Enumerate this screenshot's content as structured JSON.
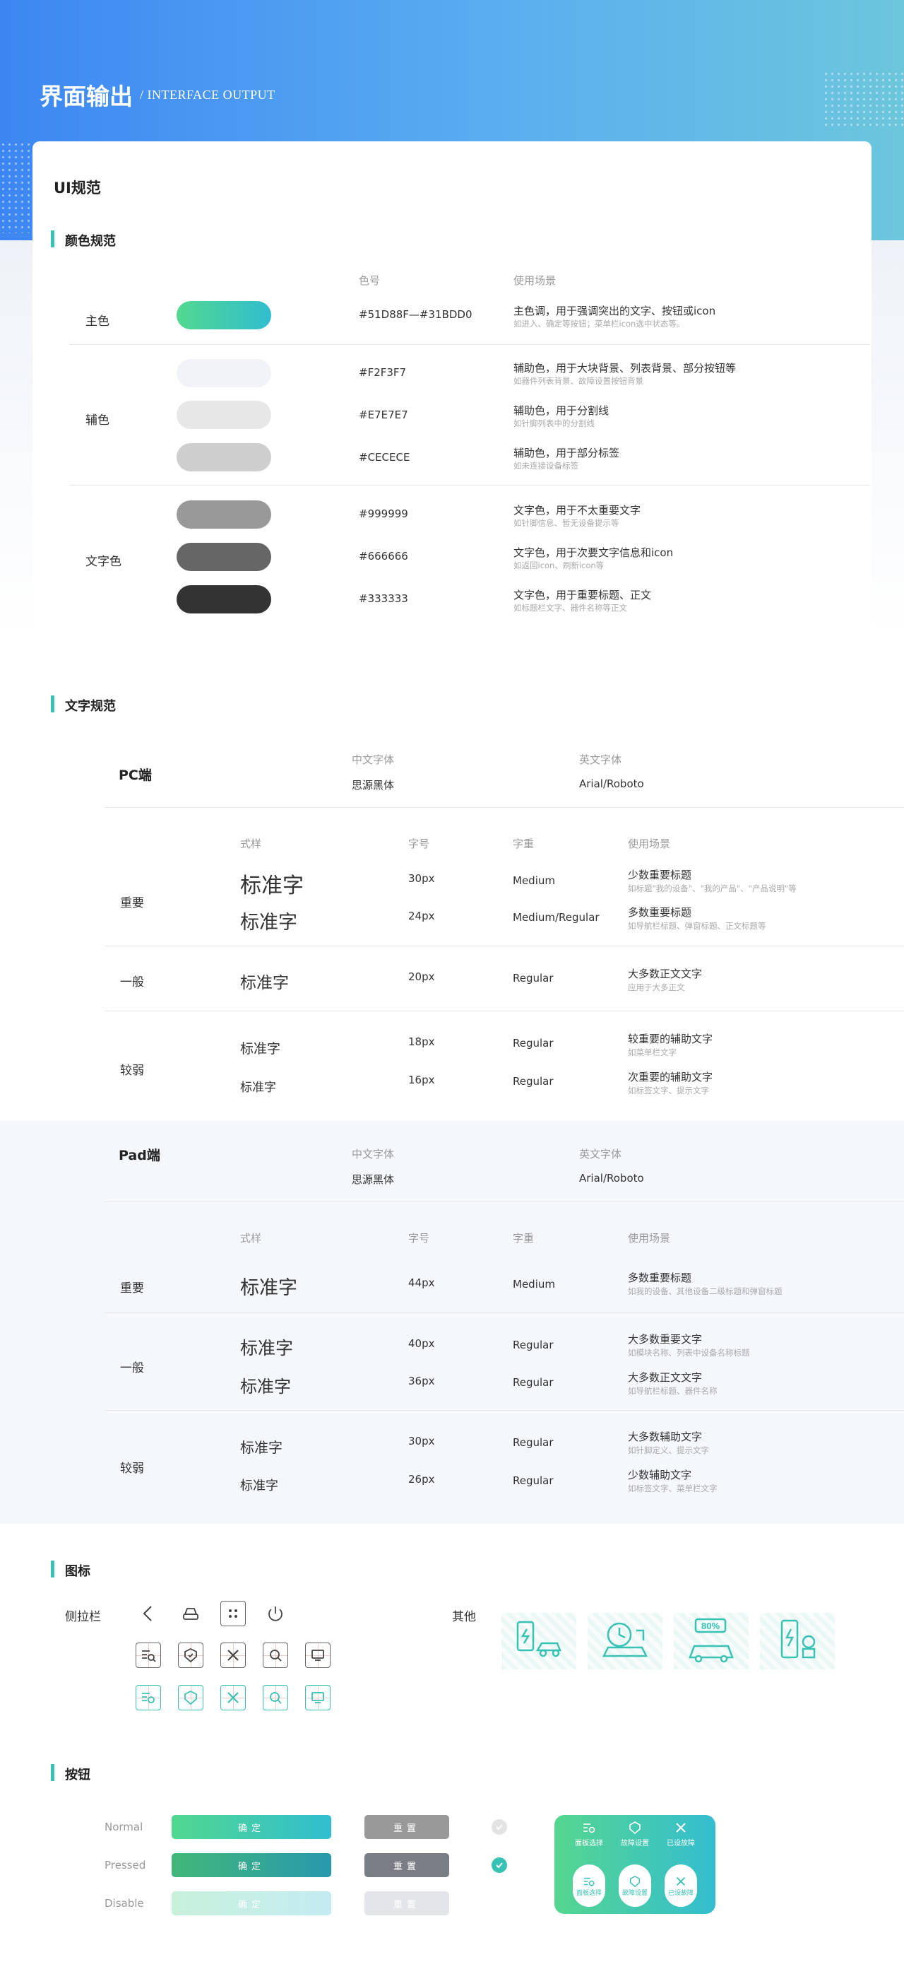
{
  "header": {
    "title": "界面输出",
    "subtitle": "/ INTERFACE OUTPUT"
  },
  "ui_spec": {
    "title": "UI规范"
  },
  "colors": {
    "section_title": "颜色规范",
    "col_code": "色号",
    "col_usage": "使用场景",
    "primary": {
      "label": "主色",
      "gradient": [
        "#51D88F",
        "#31BDD0"
      ],
      "code": "#51D88F—#31BDD0",
      "usage": "主色调，用于强调突出的文字、按钮或icon",
      "note": "如进入、确定等按钮；菜单栏icon选中状态等。"
    },
    "auxiliary": {
      "label": "辅色",
      "rows": [
        {
          "color": "#F2F3F7",
          "code": "#F2F3F7",
          "usage": "辅助色，用于大块背景、列表背景、部分按钮等",
          "note": "如器件列表背景、故障设置按钮背景"
        },
        {
          "color": "#E7E7E7",
          "code": "#E7E7E7",
          "usage": "辅助色，用于分割线",
          "note": "如针脚列表中的分割线"
        },
        {
          "color": "#CECECE",
          "code": "#CECECE",
          "usage": "辅助色，用于部分标签",
          "note": "如未连接设备标签"
        }
      ]
    },
    "text": {
      "label": "文字色",
      "rows": [
        {
          "color": "#999999",
          "code": "#999999",
          "usage": "文字色，用于不太重要文字",
          "note": "如针脚信息、暂无设备提示等"
        },
        {
          "color": "#666666",
          "code": "#666666",
          "usage": "文字色，用于次要文字信息和icon",
          "note": "如返回icon、刷新icon等"
        },
        {
          "color": "#333333",
          "code": "#333333",
          "usage": "文字色，用于重要标题、正文",
          "note": "如标题栏文字、器件名称等正文"
        }
      ]
    }
  },
  "typography": {
    "section_title": "文字规范",
    "pc": {
      "title": "PC端",
      "cn_font_label": "中文字体",
      "cn_font": "思源黑体",
      "en_font_label": "英文字体",
      "en_font": "Arial/Roboto",
      "cols": {
        "style": "式样",
        "size": "字号",
        "weight": "字重",
        "usage": "使用场景"
      },
      "groups": [
        {
          "label": "重要",
          "rows": [
            {
              "sample": "标准字",
              "size": "30px",
              "weight": "Medium",
              "usage": "少数重要标题",
              "note": "如标题\"我的设备\"、\"我的产品\"、\"产品说明\"等"
            },
            {
              "sample": "标准字",
              "size": "24px",
              "weight": "Medium/Regular",
              "usage": "多数重要标题",
              "note": "如导航栏标题、弹窗标题、正文标题等"
            }
          ]
        },
        {
          "label": "一般",
          "rows": [
            {
              "sample": "标准字",
              "size": "20px",
              "weight": "Regular",
              "usage": "大多数正文文字",
              "note": "应用于大多正文"
            }
          ]
        },
        {
          "label": "较弱",
          "rows": [
            {
              "sample": "标准字",
              "size": "18px",
              "weight": "Regular",
              "usage": "较重要的辅助文字",
              "note": "如菜单栏文字"
            },
            {
              "sample": "标准字",
              "size": "16px",
              "weight": "Regular",
              "usage": "次重要的辅助文字",
              "note": "如标签文字、提示文字"
            }
          ]
        }
      ]
    },
    "pad": {
      "title": "Pad端",
      "cn_font_label": "中文字体",
      "cn_font": "思源黑体",
      "en_font_label": "英文字体",
      "en_font": "Arial/Roboto",
      "cols": {
        "style": "式样",
        "size": "字号",
        "weight": "字重",
        "usage": "使用场景"
      },
      "groups": [
        {
          "label": "重要",
          "rows": [
            {
              "sample": "标准字",
              "size": "44px",
              "weight": "Medium",
              "usage": "多数重要标题",
              "note": "如我的设备、其他设备二级标题和弹窗标题"
            }
          ]
        },
        {
          "label": "一般",
          "rows": [
            {
              "sample": "标准字",
              "size": "40px",
              "weight": "Regular",
              "usage": "大多数重要文字",
              "note": "如模块名称、列表中设备名称标题"
            },
            {
              "sample": "标准字",
              "size": "36px",
              "weight": "Regular",
              "usage": "大多数正文文字",
              "note": "如导航栏标题、器件名称"
            }
          ]
        },
        {
          "label": "较弱",
          "rows": [
            {
              "sample": "标准字",
              "size": "30px",
              "weight": "Regular",
              "usage": "大多数辅助文字",
              "note": "如针脚定义、提示文字"
            },
            {
              "sample": "标准字",
              "size": "26px",
              "weight": "Regular",
              "usage": "少数辅助文字",
              "note": "如标签文字、菜单栏文字"
            }
          ]
        }
      ]
    }
  },
  "icons": {
    "section_title": "图标",
    "sidebar_label": "侧拉栏",
    "other_label": "其他",
    "sidebar_icons": [
      "back-icon",
      "car-icon",
      "grid-icon",
      "power-icon",
      "list-search-icon",
      "shield-check-icon",
      "tools-icon",
      "search-refresh-icon",
      "monitor-icon"
    ],
    "other_icons": [
      "charging-station-icon",
      "charging-timer-icon",
      "battery-car-icon",
      "charging-pile-icon"
    ],
    "battery_text": "80%"
  },
  "buttons": {
    "section_title": "按钮",
    "states": [
      "Normal",
      "Pressed",
      "Disable"
    ],
    "confirm_label": "确定",
    "reset_label": "重置",
    "tabbar": {
      "top": [
        "面板选择",
        "故障设置",
        "已设故障"
      ],
      "bottom": [
        "面板选择",
        "故障设置",
        "已设故障"
      ]
    }
  }
}
